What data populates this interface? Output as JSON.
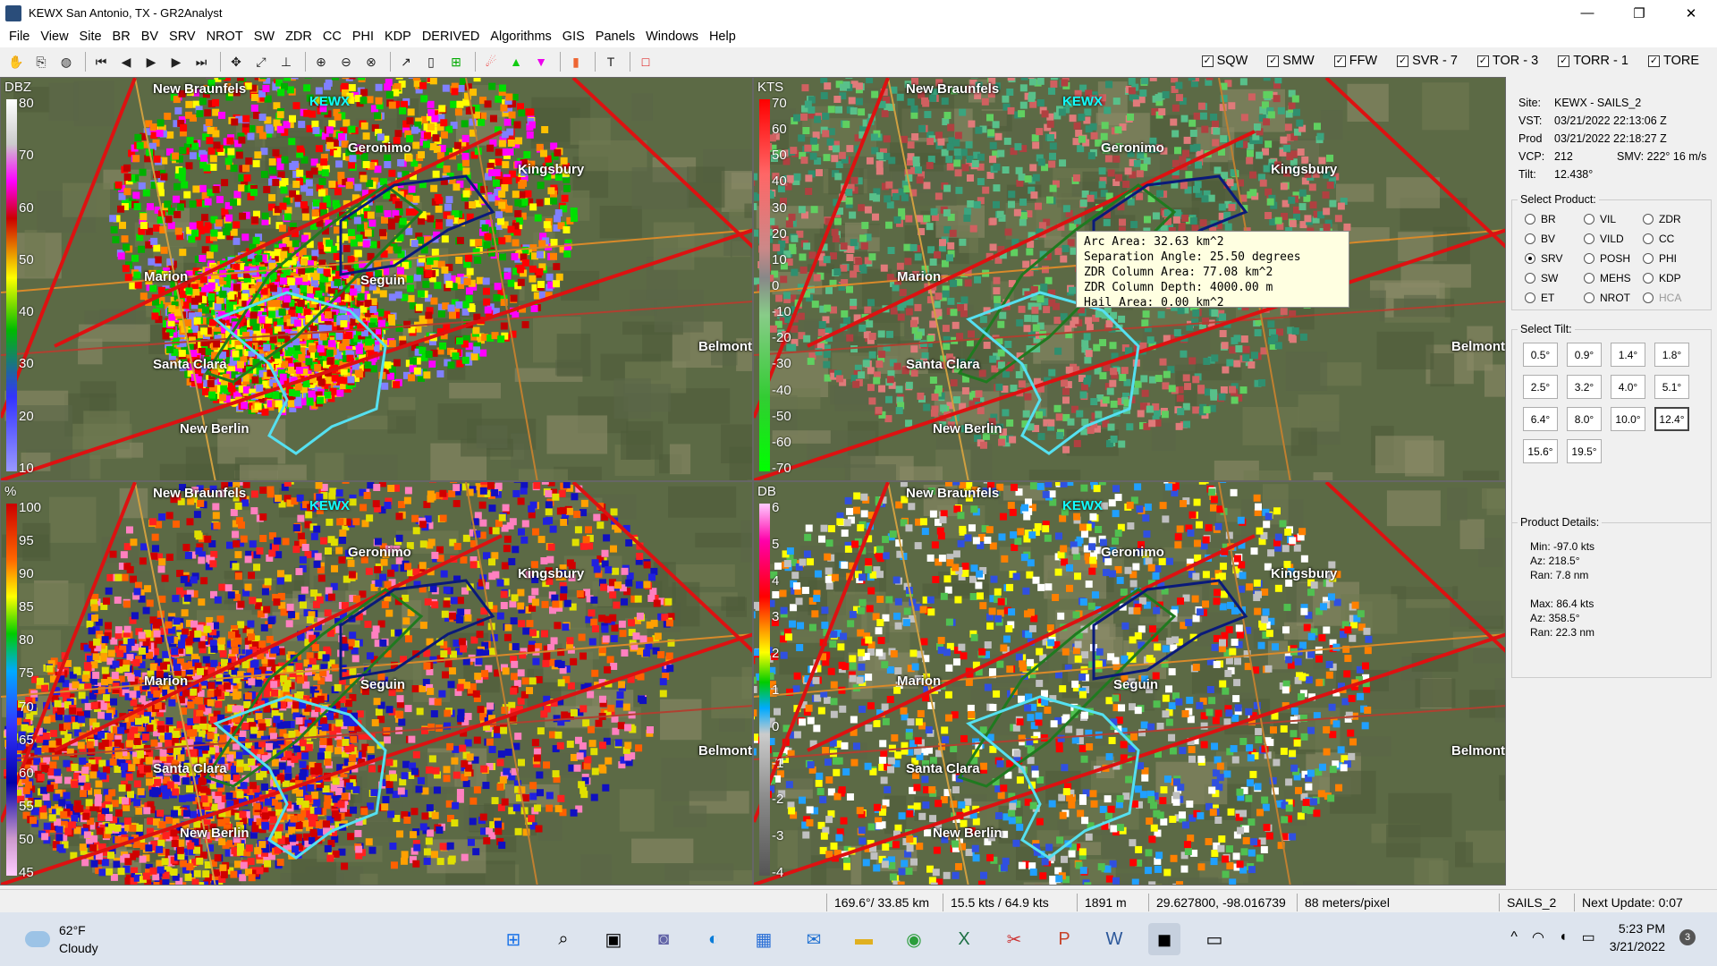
{
  "window": {
    "title": "KEWX San Antonio, TX - GR2Analyst",
    "minimize": "—",
    "restore": "❐",
    "close": "✕"
  },
  "menu": [
    "File",
    "View",
    "Site",
    "BR",
    "BV",
    "SRV",
    "NROT",
    "SW",
    "ZDR",
    "CC",
    "PHI",
    "KDP",
    "DERIVED",
    "Algorithms",
    "GIS",
    "Panels",
    "Windows",
    "Help"
  ],
  "warnings": [
    {
      "label": "SQW",
      "checked": true
    },
    {
      "label": "SMW",
      "checked": true
    },
    {
      "label": "FFW",
      "checked": true
    },
    {
      "label": "SVR - 7",
      "checked": true
    },
    {
      "label": "TOR - 3",
      "checked": true
    },
    {
      "label": "TORR - 1",
      "checked": true
    },
    {
      "label": "TORE",
      "checked": true
    }
  ],
  "panes": {
    "br": {
      "unit": "DBZ",
      "ticks": [
        "80",
        "70",
        "60",
        "50",
        "40",
        "30",
        "20",
        "10"
      ]
    },
    "srv": {
      "unit": "KTS",
      "ticks": [
        "70",
        "60",
        "50",
        "40",
        "30",
        "20",
        "10",
        "0",
        "-10",
        "-20",
        "-30",
        "-40",
        "-50",
        "-60",
        "-70"
      ]
    },
    "cc": {
      "unit": "%",
      "ticks": [
        "100",
        "95",
        "90",
        "85",
        "80",
        "75",
        "70",
        "65",
        "60",
        "55",
        "50",
        "45"
      ]
    },
    "zdr": {
      "unit": "DB",
      "ticks": [
        "6",
        "5",
        "4",
        "3",
        "2",
        "1",
        "0",
        "-1",
        "-2",
        "-3",
        "-4"
      ]
    }
  },
  "cities": {
    "new_braunfels": "New Braunfels",
    "kewx": "KEWX",
    "geronimo": "Geronimo",
    "kingsbury": "Kingsbury",
    "marion": "Marion",
    "seguin": "Seguin",
    "santa_clara": "Santa Clara",
    "new_berlin": "New Berlin",
    "belmont": "Belmont"
  },
  "tooltip": {
    "arc_area": "Arc Area: 32.63 km^2",
    "sep_angle": "Separation Angle: 25.50 degrees",
    "zdr_area": "ZDR Column Area: 77.08 km^2",
    "zdr_depth": "ZDR Column Depth: 4000.00 m",
    "hail_area": "Hail Area: 0.00 km^2"
  },
  "site_info": {
    "site_k": "Site:",
    "site_v": "KEWX - SAILS_2",
    "vst_k": "VST:",
    "vst_v": "03/21/2022  22:13:06 Z",
    "prod_k": "Prod",
    "prod_v": "03/21/2022  22:18:27 Z",
    "vcp_k": "VCP:",
    "vcp_v": "212",
    "smv": "SMV: 222° 16 m/s",
    "tilt_k": "Tilt:",
    "tilt_v": "12.438°"
  },
  "select_product": {
    "title": "Select Product:",
    "options": [
      "BR",
      "VIL",
      "ZDR",
      "BV",
      "VILD",
      "CC",
      "SRV",
      "POSH",
      "PHI",
      "SW",
      "MEHS",
      "KDP",
      "ET",
      "NROT",
      "HCA"
    ],
    "selected": "SRV"
  },
  "select_tilt": {
    "title": "Select Tilt:",
    "tilts": [
      "0.5°",
      "0.9°",
      "1.4°",
      "1.8°",
      "2.5°",
      "3.2°",
      "4.0°",
      "5.1°",
      "6.4°",
      "8.0°",
      "10.0°",
      "12.4°",
      "15.6°",
      "19.5°"
    ],
    "selected": "12.4°"
  },
  "product_details": {
    "title": "Product Details:",
    "min": "Min:  -97.0 kts",
    "min_az": "Az:   218.5°",
    "min_ran": "Ran:  7.8 nm",
    "max": "Max:  86.4 kts",
    "max_az": "Az:   358.5°",
    "max_ran": "Ran:  22.3 nm"
  },
  "status": {
    "azran": "169.6°/ 33.85 km",
    "vel": "15.5 kts / 64.9 kts",
    "height": "1891 m",
    "coords": "29.627800, -98.016739",
    "res": "88 meters/pixel",
    "mode": "SAILS_2",
    "next": "Next Update: 0:07"
  },
  "taskbar": {
    "temp": "62°F",
    "cond": "Cloudy",
    "time": "5:23 PM",
    "date": "3/21/2022",
    "notif": "3",
    "tray_up": "^",
    "wifi": "wifi-icon",
    "volume": "volume-icon",
    "battery": "battery-icon"
  },
  "colors": {
    "warn_red": "#dd1111",
    "svr_yellow": "#ffee00",
    "cyan_poly": "#55e0f0",
    "navy_poly": "#0a1a7a",
    "green_poly": "#1f7a1f"
  }
}
